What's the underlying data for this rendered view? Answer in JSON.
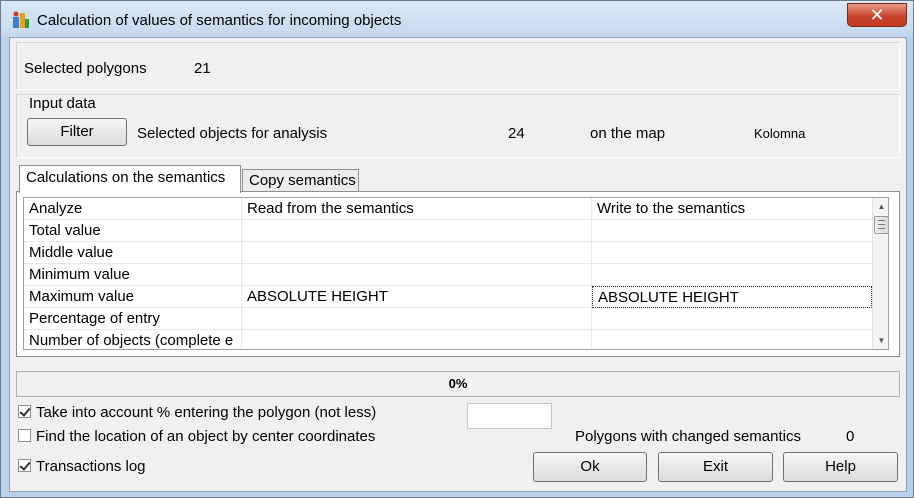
{
  "window": {
    "title": "Calculation of values of semantics for incoming objects",
    "close_label": "✕"
  },
  "summary": {
    "selected_polygons_label": "Selected polygons",
    "selected_polygons_value": "21"
  },
  "input_data": {
    "group_label": "Input data",
    "filter_button": "Filter",
    "selected_objects_label": "Selected objects for analysis",
    "selected_objects_value": "24",
    "on_map_label": "on the map",
    "map_name": "Kolomna"
  },
  "tabs": [
    {
      "label": "Calculations on the semantics",
      "active": true
    },
    {
      "label": "Copy semantics",
      "active": false
    }
  ],
  "grid": {
    "headers": [
      "Analyze",
      "Read from the semantics",
      "Write to the semantics"
    ],
    "rows": [
      {
        "analyze": "Total value",
        "read": "",
        "write": ""
      },
      {
        "analyze": "Middle value",
        "read": "",
        "write": ""
      },
      {
        "analyze": "Minimum value",
        "read": "",
        "write": ""
      },
      {
        "analyze": "Maximum value",
        "read": "ABSOLUTE HEIGHT",
        "write": "ABSOLUTE HEIGHT"
      },
      {
        "analyze": "Percentage of entry",
        "read": "",
        "write": ""
      },
      {
        "analyze": "Number of objects (complete e",
        "read": "",
        "write": ""
      }
    ]
  },
  "progress": {
    "value": 0,
    "label": "0%"
  },
  "options": {
    "take_into_account_label": "Take into account % entering the polygon (not less)",
    "take_into_account_checked": true,
    "percent_value": "",
    "find_location_label": "Find the location of an object by center coordinates",
    "find_location_checked": false,
    "transactions_log_label": "Transactions log",
    "transactions_log_checked": true
  },
  "status": {
    "changed_label": "Polygons with changed semantics",
    "changed_value": "0"
  },
  "buttons": {
    "ok": "Ok",
    "exit": "Exit",
    "help": "Help"
  },
  "colors": {
    "frame": "#b9d1ea",
    "client": "#f0f0f0",
    "close": "#c8452b"
  }
}
